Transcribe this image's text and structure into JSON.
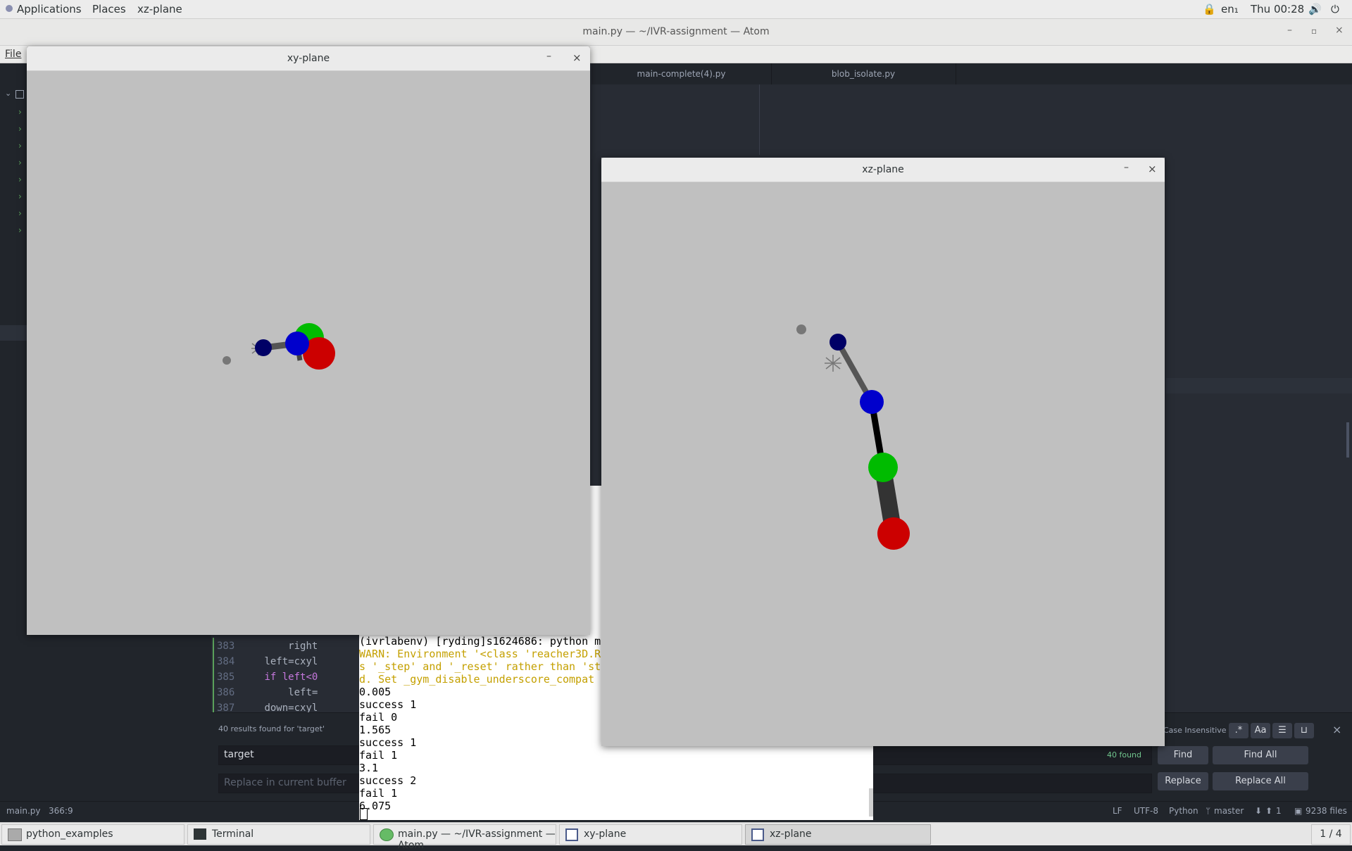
{
  "topbar": {
    "applications": "Applications",
    "places": "Places",
    "active_app": "xz-plane",
    "language": "en₁",
    "clock": "Thu 00:28"
  },
  "atom": {
    "title": "main.py — ~/IVR-assignment — Atom",
    "menu_file": "File",
    "tabs": [
      "main-complete(4).py",
      "blob_isolate.py"
    ],
    "code_lines": [
      {
        "num": "383",
        "text": "        right"
      },
      {
        "num": "384",
        "text": "    left=cxyl"
      },
      {
        "num": "385",
        "text": "    if left<0"
      },
      {
        "num": "386",
        "text": "        left="
      },
      {
        "num": "387",
        "text": "    down=cxyl"
      }
    ],
    "find": {
      "results_text": "40 results found for 'target'",
      "find_value": "target",
      "replace_placeholder": "Replace in current buffer",
      "found_count": "40 found",
      "case_label": "Case Insensitive",
      "find_button": "Find",
      "find_all_button": "Find All",
      "replace_button": "Replace",
      "replace_all_button": "Replace All",
      "regex_label": ".*",
      "case_toggle_label": "Aa"
    },
    "status": {
      "file": "main.py",
      "cursor": "366:9",
      "line_ending": "LF",
      "encoding": "UTF-8",
      "grammar": "Python",
      "branch": "master",
      "push_count": "1",
      "files": "9238 files"
    }
  },
  "terminal": {
    "lines": [
      {
        "text": "(ivrlabenv) [ryding]s1624686: python m",
        "color": "#000000"
      },
      {
        "text": "WARN: Environment '<class 'reacher3D.R",
        "color": "#c4a000"
      },
      {
        "text": "s '_step' and '_reset' rather than 'st",
        "color": "#c4a000"
      },
      {
        "text": "d. Set _gym_disable_underscore_compat",
        "color": "#c4a000"
      },
      {
        "text": "0.005",
        "color": "#000000"
      },
      {
        "text": "success 1",
        "color": "#000000"
      },
      {
        "text": "fail 0",
        "color": "#000000"
      },
      {
        "text": "1.565",
        "color": "#000000"
      },
      {
        "text": "success 1",
        "color": "#000000"
      },
      {
        "text": "fail 1",
        "color": "#000000"
      },
      {
        "text": "3.1",
        "color": "#000000"
      },
      {
        "text": "success 2",
        "color": "#000000"
      },
      {
        "text": "fail 1",
        "color": "#000000"
      },
      {
        "text": "6.075",
        "color": "#000000"
      }
    ]
  },
  "windows": {
    "xy": {
      "title": "xy-plane",
      "minimize": "–",
      "close": "×"
    },
    "xz": {
      "title": "xz-plane",
      "minimize": "–",
      "close": "×"
    }
  },
  "taskbar": {
    "items": [
      "python_examples",
      "Terminal",
      "main.py — ~/IVR-assignment — Atom",
      "xy-plane",
      "xz-plane"
    ],
    "workspace": "1 / 4"
  },
  "colors": {
    "joint_dark": "#000066",
    "joint_blue": "#0000cc",
    "joint_green": "#00bb00",
    "joint_red": "#cc0000",
    "target_grey": "#777777",
    "link_grey": "#555555",
    "link_black": "#000000"
  }
}
